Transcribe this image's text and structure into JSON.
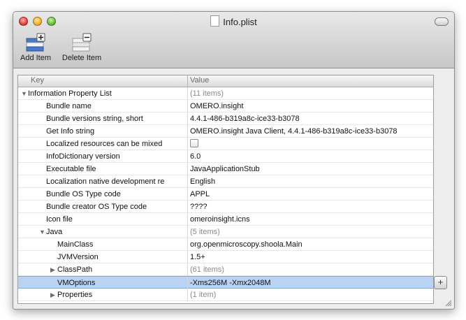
{
  "window": {
    "title": "Info.plist"
  },
  "toolbar": {
    "add_label": "Add Item",
    "delete_label": "Delete Item"
  },
  "table": {
    "col_key": "Key",
    "col_value": "Value",
    "rows": [
      {
        "key": "Information Property List",
        "value": "(11 items)",
        "level": 0,
        "disclosure": "open",
        "dim": true
      },
      {
        "key": "Bundle name",
        "value": "OMERO.insight",
        "level": 1
      },
      {
        "key": "Bundle versions string, short",
        "value": "4.4.1-486-b319a8c-ice33-b3078",
        "level": 1
      },
      {
        "key": "Get Info string",
        "value": "OMERO.insight Java Client, 4.4.1-486-b319a8c-ice33-b3078",
        "level": 1
      },
      {
        "key": "Localized resources can be mixed",
        "value": "",
        "level": 1,
        "checkbox": true
      },
      {
        "key": "InfoDictionary version",
        "value": "6.0",
        "level": 1
      },
      {
        "key": "Executable file",
        "value": "JavaApplicationStub",
        "level": 1
      },
      {
        "key": "Localization native development re",
        "value": "English",
        "level": 1
      },
      {
        "key": "Bundle OS Type code",
        "value": "APPL",
        "level": 1
      },
      {
        "key": "Bundle creator OS Type code",
        "value": "????",
        "level": 1
      },
      {
        "key": "Icon file",
        "value": "omeroinsight.icns",
        "level": 1
      },
      {
        "key": "Java",
        "value": "(5 items)",
        "level": 1,
        "disclosure": "open",
        "dim": true
      },
      {
        "key": "MainClass",
        "value": "org.openmicroscopy.shoola.Main",
        "level": 2
      },
      {
        "key": "JVMVersion",
        "value": "1.5+",
        "level": 2
      },
      {
        "key": "ClassPath",
        "value": "(61 items)",
        "level": 2,
        "disclosure": "closed",
        "dim": true
      },
      {
        "key": "VMOptions",
        "value": "-Xms256M -Xmx2048M",
        "level": 2,
        "selected": true
      },
      {
        "key": "Properties",
        "value": "(1 item)",
        "level": 2,
        "disclosure": "closed",
        "dim": true
      }
    ]
  },
  "add_row_button": "+"
}
